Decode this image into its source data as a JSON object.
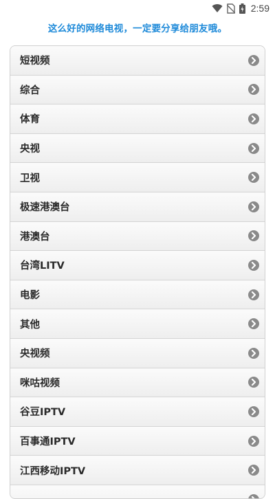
{
  "status_bar": {
    "time": "2:59",
    "icons": [
      "wifi-icon",
      "no-sim-icon",
      "battery-icon"
    ]
  },
  "banner": {
    "text": "这么好的网络电视，一定要分享给朋友哦。"
  },
  "channels": [
    {
      "label": "短视频"
    },
    {
      "label": "综合"
    },
    {
      "label": "体育"
    },
    {
      "label": "央视"
    },
    {
      "label": "卫视"
    },
    {
      "label": "极速港澳台"
    },
    {
      "label": "港澳台"
    },
    {
      "label": "台湾LITV"
    },
    {
      "label": "电影"
    },
    {
      "label": "其他"
    },
    {
      "label": "央视频"
    },
    {
      "label": "咪咕视频"
    },
    {
      "label": "谷豆IPTV"
    },
    {
      "label": "百事通IPTV"
    },
    {
      "label": "江西移动IPTV"
    },
    {
      "label": ""
    }
  ],
  "colors": {
    "banner": "#1e8ad9",
    "chevron": "#8a8a8a",
    "row_border": "#d4d4d4"
  }
}
